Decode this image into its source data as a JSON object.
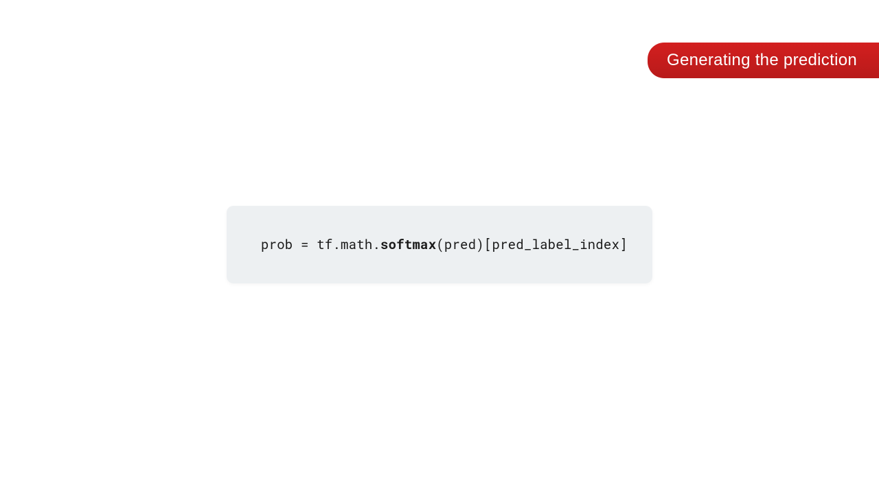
{
  "banner": {
    "text": "Generating the prediction"
  },
  "code": {
    "part1": "prob = tf.math.",
    "bold": "softmax",
    "part2": "(pred)[pred_label_index]"
  }
}
